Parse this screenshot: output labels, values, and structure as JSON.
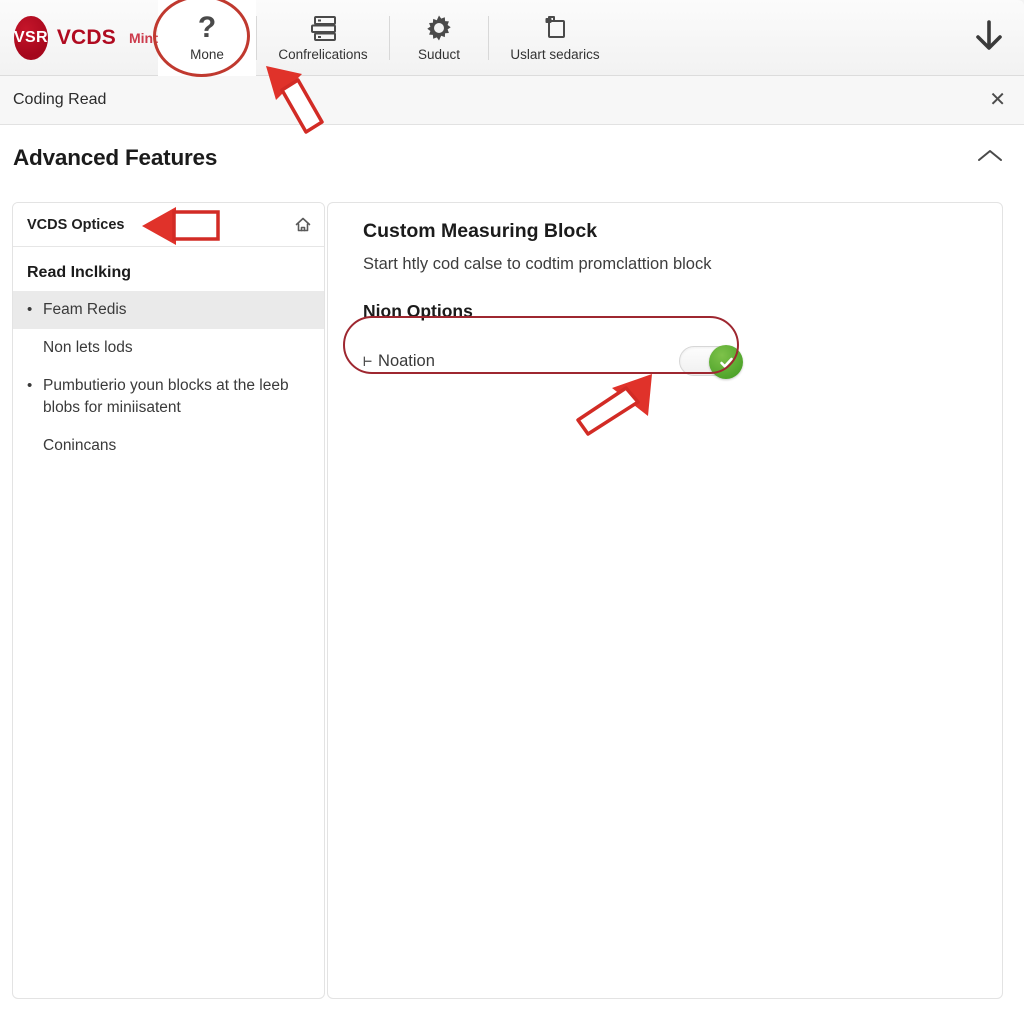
{
  "brand": {
    "badge": "VSR",
    "name": "VCDS",
    "sub": "Mind"
  },
  "toolbar": {
    "items": [
      {
        "label": "Mone",
        "icon": "question-mark-icon",
        "active": true
      },
      {
        "label": "Confrelications",
        "icon": "server-list-icon",
        "active": false
      },
      {
        "label": "Suduct",
        "icon": "gear-icon",
        "active": false
      },
      {
        "label": "Uslart sedarics",
        "icon": "plug-document-icon",
        "active": false
      }
    ],
    "download_icon": "download-anchor-icon"
  },
  "subbar": {
    "title": "Coding Read",
    "close_label": "✕"
  },
  "section": {
    "title": "Advanced Features",
    "collapse_icon": "chevron-up-icon"
  },
  "sidebar": {
    "header_title": "VCDS Optices",
    "home_icon": "home-icon",
    "list_heading": "Read Inclking",
    "items": [
      {
        "label": "Feam Redis",
        "bullet": true,
        "selected": true
      },
      {
        "label": "Non lets lods",
        "bullet": false,
        "selected": false
      },
      {
        "label": "Pumbutierio youn blocks at the leeb blobs for miniisatent",
        "bullet": true,
        "selected": false
      },
      {
        "label": "Conincans",
        "bullet": false,
        "selected": false
      }
    ]
  },
  "content": {
    "title": "Custom Measuring Block",
    "description": "Start htly cod calse to codtim promclattion block",
    "options_heading": "Nion Options",
    "option": {
      "glyph": "⊢",
      "label": "Noation",
      "toggle_state": "on",
      "toggle_icon": "check-icon"
    }
  },
  "colors": {
    "brand_red": "#b00a20",
    "annotation_red": "#c0392f",
    "toggle_green": "#4ea32a",
    "selected_row": "#eaeaea"
  },
  "annotations": [
    {
      "name": "highlight-ellipse-toolbar-mone",
      "shape": "ellipse"
    },
    {
      "name": "arrow-to-confrelications",
      "shape": "arrow",
      "direction": "up-left"
    },
    {
      "name": "arrow-to-sidebar-header",
      "shape": "arrow",
      "direction": "left"
    },
    {
      "name": "highlight-ellipse-option-row",
      "shape": "ellipse"
    },
    {
      "name": "arrow-to-toggle",
      "shape": "arrow",
      "direction": "up-right"
    }
  ]
}
